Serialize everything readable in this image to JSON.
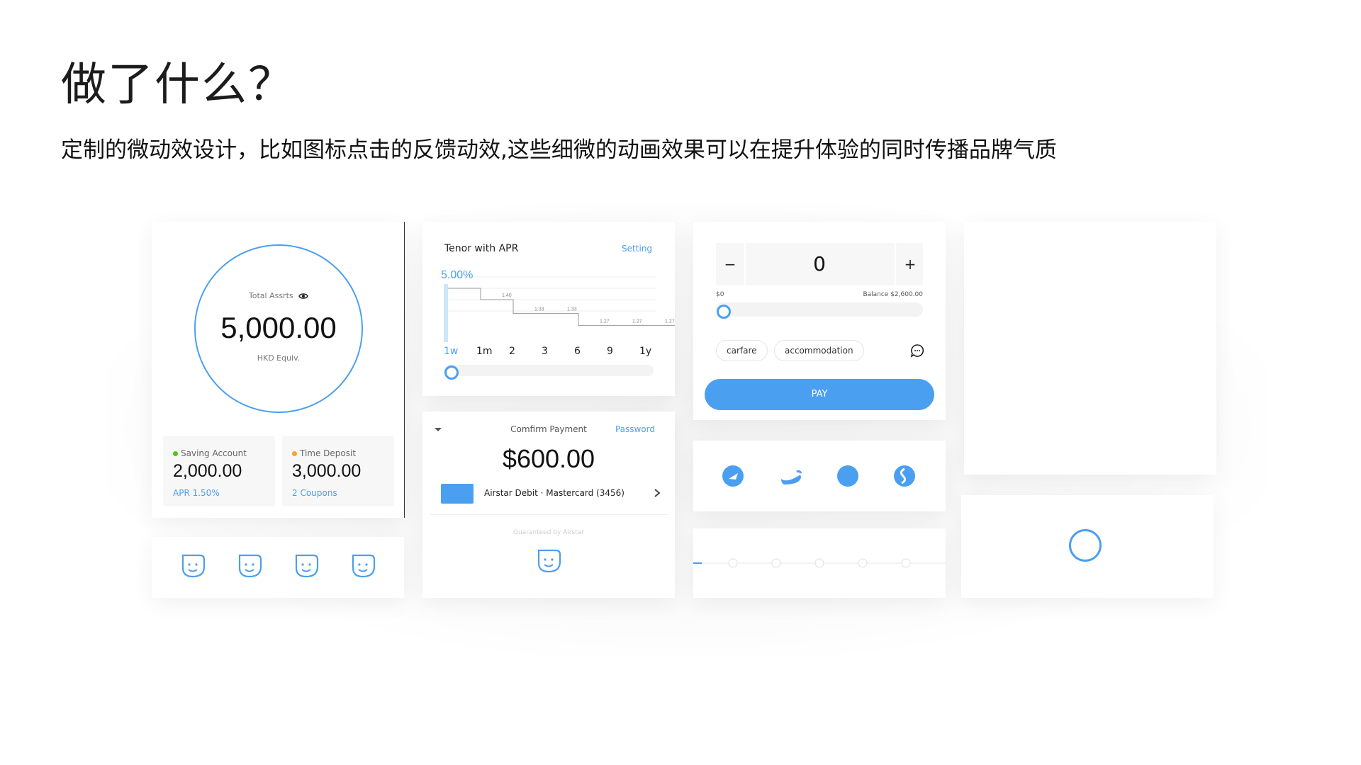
{
  "slide": {
    "title": "做了什么？",
    "subtitle": "定制的微动效设计，比如图标点击的反馈动效,这些细微的动画效果可以在提升体验的同时传播品牌气质"
  },
  "assets_card": {
    "label": "Total Assrts",
    "amount": "5,000.00",
    "sub": "HKD Equiv.",
    "accounts": [
      {
        "name": "Saving Account",
        "value": "2,000.00",
        "sub": "APR 1.50%",
        "dot_color": "#52c41a"
      },
      {
        "name": "Time Deposit",
        "value": "3,000.00",
        "sub": "2 Coupons",
        "dot_color": "#f5a623"
      }
    ]
  },
  "tenor_card": {
    "title": "Tenor with APR",
    "setting": "Setting",
    "current_rate": "5.00%",
    "ticks": [
      "1w",
      "1m",
      "2",
      "3",
      "6",
      "9",
      "1y"
    ],
    "slider_position": 0
  },
  "chart_data": {
    "type": "line",
    "title": "Tenor with APR",
    "categories": [
      "1w",
      "1m",
      "2",
      "3",
      "6",
      "9",
      "1y"
    ],
    "series": [
      {
        "values": [
          5.0,
          1.4,
          1.33,
          1.33,
          1.27,
          1.27,
          1.27
        ]
      }
    ],
    "data_labels": [
      "5.00%",
      "1.40",
      "1.33",
      "1.33",
      "1.27",
      "1.27",
      "1.27"
    ],
    "grid": true
  },
  "stepper_card": {
    "minus": "−",
    "value": "0",
    "plus": "+",
    "min_label": "$0",
    "balance_label": "Balance $2,600.00",
    "slider_position": 0,
    "chips": [
      "carfare",
      "accommodation"
    ],
    "pay": "PAY"
  },
  "payment_card": {
    "title": "Comfirm Payment",
    "password": "Password",
    "amount": "$600.00",
    "method": "Airstar Debit · Mastercard (3456)",
    "guarantee": "Guaranteed by Airstar"
  },
  "colors": {
    "accent": "#4a9ff0",
    "track": "#f3f3f3"
  },
  "icons": [
    "eye-icon",
    "chevron-right-icon",
    "caret-down-icon",
    "chat-icon",
    "smiley-icon",
    "spinner-ring-icon"
  ],
  "progress_steps": {
    "total": 6,
    "current": 1
  }
}
